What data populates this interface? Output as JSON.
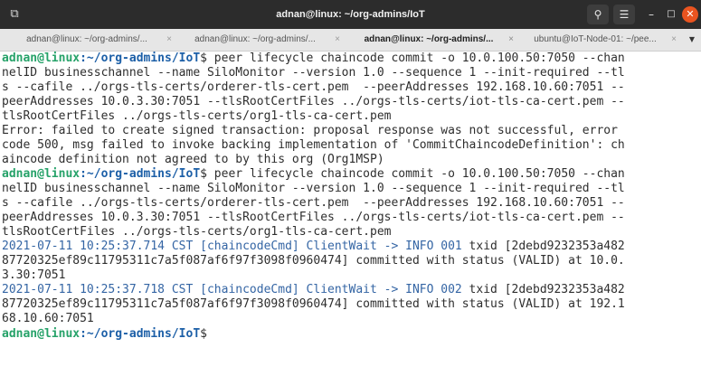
{
  "window": {
    "title": "adnan@linux: ~/org-admins/IoT",
    "new_tab_icon": "new-tab-icon",
    "search_icon": "search-icon",
    "menu_icon": "hamburger-menu-icon",
    "minimize_icon": "minimize-icon",
    "maximize_icon": "maximize-icon",
    "close_icon": "close-icon",
    "close_color": "#e95420"
  },
  "tabs": [
    {
      "label": "adnan@linux: ~/org-admins/...",
      "active": false
    },
    {
      "label": "adnan@linux: ~/org-admins/...",
      "active": false
    },
    {
      "label": "adnan@linux: ~/org-admins/...",
      "active": true
    },
    {
      "label": "ubuntu@IoT-Node-01: ~/pee...",
      "active": false
    }
  ],
  "terminal": {
    "prompt_user": "adnan@linux",
    "prompt_path": ":~/org-admins/IoT",
    "lines": [
      {
        "kind": "prompt",
        "prompt": "adnan@linux",
        "path": ":~/org-admins/IoT",
        "text": "$ peer lifecycle chaincode commit -o 10.0.100.50:7050 --chan"
      },
      {
        "kind": "plain",
        "text": "nelID businesschannel --name SiloMonitor --version 1.0 --sequence 1 --init-required --tl"
      },
      {
        "kind": "plain",
        "text": "s --cafile ../orgs-tls-certs/orderer-tls-cert.pem  --peerAddresses 192.168.10.60:7051 --"
      },
      {
        "kind": "plain",
        "text": "peerAddresses 10.0.3.30:7051 --tlsRootCertFiles ../orgs-tls-certs/iot-tls-ca-cert.pem --"
      },
      {
        "kind": "plain",
        "text": "tlsRootCertFiles ../orgs-tls-certs/org1-tls-ca-cert.pem"
      },
      {
        "kind": "plain",
        "text": "Error: failed to create signed transaction: proposal response was not successful, error"
      },
      {
        "kind": "plain",
        "text": "code 500, msg failed to invoke backing implementation of 'CommitChaincodeDefinition': ch"
      },
      {
        "kind": "plain",
        "text": "aincode definition not agreed to by this org (Org1MSP)"
      },
      {
        "kind": "prompt",
        "prompt": "adnan@linux",
        "path": ":~/org-admins/IoT",
        "text": "$ peer lifecycle chaincode commit -o 10.0.100.50:7050 --chan"
      },
      {
        "kind": "plain",
        "text": "nelID businesschannel --name SiloMonitor --version 1.0 --sequence 1 --init-required --tl"
      },
      {
        "kind": "plain",
        "text": "s --cafile ../orgs-tls-certs/orderer-tls-cert.pem  --peerAddresses 192.168.10.60:7051 --"
      },
      {
        "kind": "plain",
        "text": "peerAddresses 10.0.3.30:7051 --tlsRootCertFiles ../orgs-tls-certs/iot-tls-ca-cert.pem --"
      },
      {
        "kind": "plain",
        "text": "tlsRootCertFiles ../orgs-tls-certs/org1-tls-ca-cert.pem"
      },
      {
        "kind": "log",
        "log": "2021-07-11 10:25:37.714 CST [chaincodeCmd] ClientWait -> INFO 001",
        "text": " txid [2debd9232353a482"
      },
      {
        "kind": "plain",
        "text": "87720325ef89c11795311c7a5f087af6f97f3098f0960474] committed with status (VALID) at 10.0."
      },
      {
        "kind": "plain",
        "text": "3.30:7051"
      },
      {
        "kind": "log",
        "log": "2021-07-11 10:25:37.718 CST [chaincodeCmd] ClientWait -> INFO 002",
        "text": " txid [2debd9232353a482"
      },
      {
        "kind": "plain",
        "text": "87720325ef89c11795311c7a5f087af6f97f3098f0960474] committed with status (VALID) at 192.1"
      },
      {
        "kind": "plain",
        "text": "68.10.60:7051"
      },
      {
        "kind": "prompt",
        "prompt": "adnan@linux",
        "path": ":~/org-admins/IoT",
        "text": "$ "
      }
    ]
  },
  "colors": {
    "prompt_user": "#26a269",
    "prompt_path": "#1c5fa7",
    "log_prefix": "#3465a4",
    "titlebar": "#2c2c2c"
  }
}
